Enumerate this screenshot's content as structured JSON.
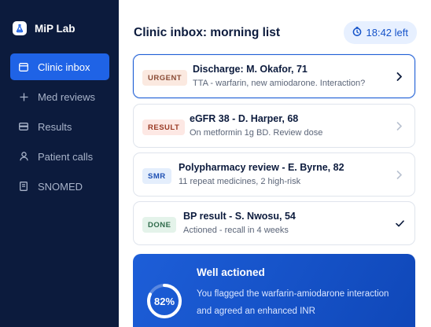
{
  "app": {
    "name": "MiP Lab",
    "logo_icon": "flask-icon"
  },
  "nav": {
    "items": [
      {
        "label": "Clinic inbox",
        "icon": "inbox-icon",
        "active": true
      },
      {
        "label": "Med reviews",
        "icon": "plus-icon",
        "active": false
      },
      {
        "label": "Results",
        "icon": "results-icon",
        "active": false
      },
      {
        "label": "Patient calls",
        "icon": "person-icon",
        "active": false
      },
      {
        "label": "SNOMED",
        "icon": "book-icon",
        "active": false
      }
    ]
  },
  "header": {
    "title": "Clinic inbox: morning list",
    "timer_label": "18:42 left",
    "timer_icon": "clock-icon"
  },
  "inbox": {
    "items": [
      {
        "tag": "URGENT",
        "title": "Discharge: M. Okafor, 71",
        "subtitle": "TTA - warfarin, new amiodarone. Interaction?",
        "action": "chevron-right-icon",
        "selected": true
      },
      {
        "tag": "RESULT",
        "title": "eGFR 38 - D. Harper, 68",
        "subtitle": "On metformin 1g BD. Review dose",
        "action": "chevron-right-icon",
        "selected": false
      },
      {
        "tag": "SMR",
        "title": "Polypharmacy review - E. Byrne, 82",
        "subtitle": "11 repeat medicines, 2 high-risk",
        "action": "chevron-right-icon",
        "selected": false
      },
      {
        "tag": "DONE",
        "title": "BP result - S. Nwosu, 54",
        "subtitle": "Actioned - recall in 4 weeks",
        "action": "check-icon",
        "selected": false
      }
    ]
  },
  "summary": {
    "title": "Well actioned",
    "text": "You flagged the warfarin-amiodarone interaction and agreed an enhanced INR",
    "score_label": "82%",
    "score_value": 0.82
  },
  "colors": {
    "sidebar_bg": "#0c1b3d",
    "accent": "#1f63e6",
    "summary_bg": "#1d5ed8",
    "urgent_tag": "#fbe9e0",
    "result_tag": "#fde8e4",
    "smr_tag": "#e4eefc",
    "done_tag": "#e4f3ea"
  }
}
